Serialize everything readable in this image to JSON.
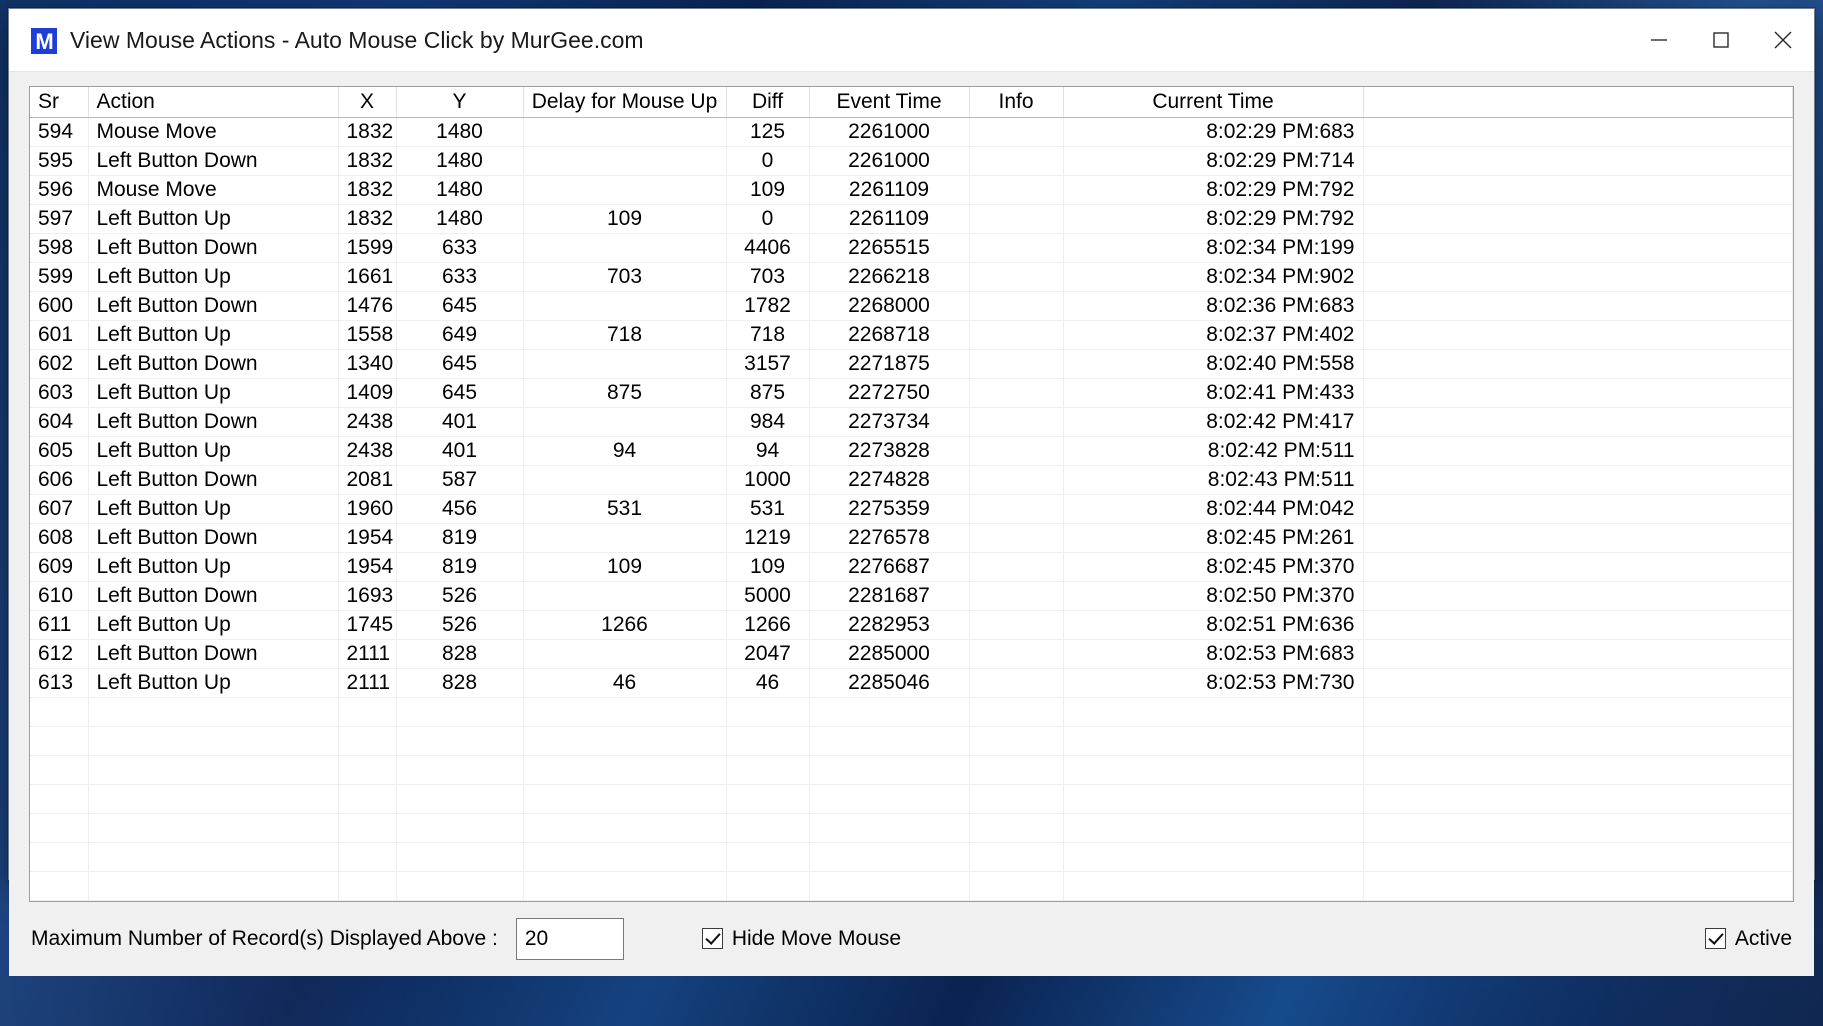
{
  "window": {
    "title": "View Mouse Actions - Auto Mouse Click by MurGee.com",
    "icon_letter": "M",
    "minimize_label": "Minimize",
    "maximize_label": "Maximize",
    "close_label": "Close"
  },
  "table": {
    "columns": [
      "Sr",
      "Action",
      "X",
      "Y",
      "Delay for Mouse Up",
      "Diff",
      "Event Time",
      "Info",
      "Current Time"
    ],
    "rows": [
      {
        "sr": "594",
        "action": "Mouse Move",
        "x": "1832",
        "y": "1480",
        "delay": "",
        "diff": "125",
        "event_time": "2261000",
        "info": "",
        "current_time": "8:02:29 PM:683"
      },
      {
        "sr": "595",
        "action": "Left Button Down",
        "x": "1832",
        "y": "1480",
        "delay": "",
        "diff": "0",
        "event_time": "2261000",
        "info": "",
        "current_time": "8:02:29 PM:714"
      },
      {
        "sr": "596",
        "action": "Mouse Move",
        "x": "1832",
        "y": "1480",
        "delay": "",
        "diff": "109",
        "event_time": "2261109",
        "info": "",
        "current_time": "8:02:29 PM:792"
      },
      {
        "sr": "597",
        "action": "Left Button Up",
        "x": "1832",
        "y": "1480",
        "delay": "109",
        "diff": "0",
        "event_time": "2261109",
        "info": "",
        "current_time": "8:02:29 PM:792"
      },
      {
        "sr": "598",
        "action": "Left Button Down",
        "x": "1599",
        "y": "633",
        "delay": "",
        "diff": "4406",
        "event_time": "2265515",
        "info": "",
        "current_time": "8:02:34 PM:199"
      },
      {
        "sr": "599",
        "action": "Left Button Up",
        "x": "1661",
        "y": "633",
        "delay": "703",
        "diff": "703",
        "event_time": "2266218",
        "info": "",
        "current_time": "8:02:34 PM:902"
      },
      {
        "sr": "600",
        "action": "Left Button Down",
        "x": "1476",
        "y": "645",
        "delay": "",
        "diff": "1782",
        "event_time": "2268000",
        "info": "",
        "current_time": "8:02:36 PM:683"
      },
      {
        "sr": "601",
        "action": "Left Button Up",
        "x": "1558",
        "y": "649",
        "delay": "718",
        "diff": "718",
        "event_time": "2268718",
        "info": "",
        "current_time": "8:02:37 PM:402"
      },
      {
        "sr": "602",
        "action": "Left Button Down",
        "x": "1340",
        "y": "645",
        "delay": "",
        "diff": "3157",
        "event_time": "2271875",
        "info": "",
        "current_time": "8:02:40 PM:558"
      },
      {
        "sr": "603",
        "action": "Left Button Up",
        "x": "1409",
        "y": "645",
        "delay": "875",
        "diff": "875",
        "event_time": "2272750",
        "info": "",
        "current_time": "8:02:41 PM:433"
      },
      {
        "sr": "604",
        "action": "Left Button Down",
        "x": "2438",
        "y": "401",
        "delay": "",
        "diff": "984",
        "event_time": "2273734",
        "info": "",
        "current_time": "8:02:42 PM:417"
      },
      {
        "sr": "605",
        "action": "Left Button Up",
        "x": "2438",
        "y": "401",
        "delay": "94",
        "diff": "94",
        "event_time": "2273828",
        "info": "",
        "current_time": "8:02:42 PM:511"
      },
      {
        "sr": "606",
        "action": "Left Button Down",
        "x": "2081",
        "y": "587",
        "delay": "",
        "diff": "1000",
        "event_time": "2274828",
        "info": "",
        "current_time": "8:02:43 PM:511"
      },
      {
        "sr": "607",
        "action": "Left Button Up",
        "x": "1960",
        "y": "456",
        "delay": "531",
        "diff": "531",
        "event_time": "2275359",
        "info": "",
        "current_time": "8:02:44 PM:042"
      },
      {
        "sr": "608",
        "action": "Left Button Down",
        "x": "1954",
        "y": "819",
        "delay": "",
        "diff": "1219",
        "event_time": "2276578",
        "info": "",
        "current_time": "8:02:45 PM:261"
      },
      {
        "sr": "609",
        "action": "Left Button Up",
        "x": "1954",
        "y": "819",
        "delay": "109",
        "diff": "109",
        "event_time": "2276687",
        "info": "",
        "current_time": "8:02:45 PM:370"
      },
      {
        "sr": "610",
        "action": "Left Button Down",
        "x": "1693",
        "y": "526",
        "delay": "",
        "diff": "5000",
        "event_time": "2281687",
        "info": "",
        "current_time": "8:02:50 PM:370"
      },
      {
        "sr": "611",
        "action": "Left Button Up",
        "x": "1745",
        "y": "526",
        "delay": "1266",
        "diff": "1266",
        "event_time": "2282953",
        "info": "",
        "current_time": "8:02:51 PM:636"
      },
      {
        "sr": "612",
        "action": "Left Button Down",
        "x": "2111",
        "y": "828",
        "delay": "",
        "diff": "2047",
        "event_time": "2285000",
        "info": "",
        "current_time": "8:02:53 PM:683"
      },
      {
        "sr": "613",
        "action": "Left Button Up",
        "x": "2111",
        "y": "828",
        "delay": "46",
        "diff": "46",
        "event_time": "2285046",
        "info": "",
        "current_time": "8:02:53 PM:730"
      }
    ],
    "empty_row_count": 7
  },
  "footer": {
    "max_records_label": "Maximum Number of Record(s) Displayed Above :",
    "max_records_value": "20",
    "hide_move_mouse_label": "Hide Move Mouse",
    "hide_move_mouse_checked": true,
    "active_label": "Active",
    "active_checked": true
  },
  "colors": {
    "title_text": "#1a1a1a",
    "icon_blue": "#1d3fd8",
    "window_bg": "#f0f0f0",
    "grid_bg": "#ffffff",
    "grid_line": "#efefef"
  }
}
